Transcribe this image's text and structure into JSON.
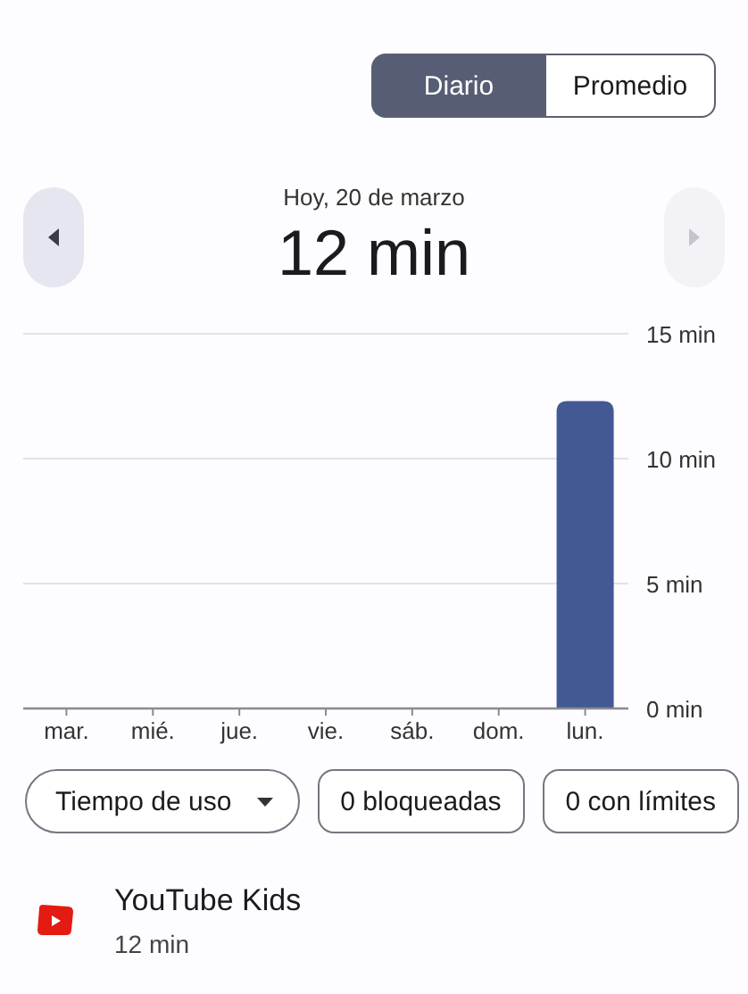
{
  "view_toggle": [
    {
      "label": "Diario",
      "selected": true
    },
    {
      "label": "Promedio",
      "selected": false
    }
  ],
  "day_nav": {
    "date": "Hoy, 20 de marzo",
    "total": "12 min",
    "previous_disabled": false,
    "next_disabled": true
  },
  "usage_chart": {
    "chart_data": {
      "type": "bar",
      "categories": [
        "mar.",
        "mié.",
        "jue.",
        "vie.",
        "sáb.",
        "dom.",
        "lun."
      ],
      "series": [
        {
          "color": "#435994",
          "values": [
            0,
            0,
            0,
            0,
            0,
            0,
            12.3
          ]
        }
      ],
      "ylim": [
        0,
        15
      ],
      "yticks": [
        {
          "value": 0,
          "label": "0 min"
        },
        {
          "value": 5,
          "label": "5 min"
        },
        {
          "value": 10,
          "label": "10 min"
        },
        {
          "value": 15,
          "label": "15 min"
        }
      ]
    }
  },
  "filters": [
    {
      "kind": "dropdown",
      "label": "Tiempo de uso"
    },
    {
      "kind": "chip",
      "label": "0 bloqueadas"
    },
    {
      "kind": "chip",
      "label": "0 con límites"
    }
  ],
  "apps": [
    {
      "name": "YouTube Kids",
      "time": "12 min"
    }
  ]
}
